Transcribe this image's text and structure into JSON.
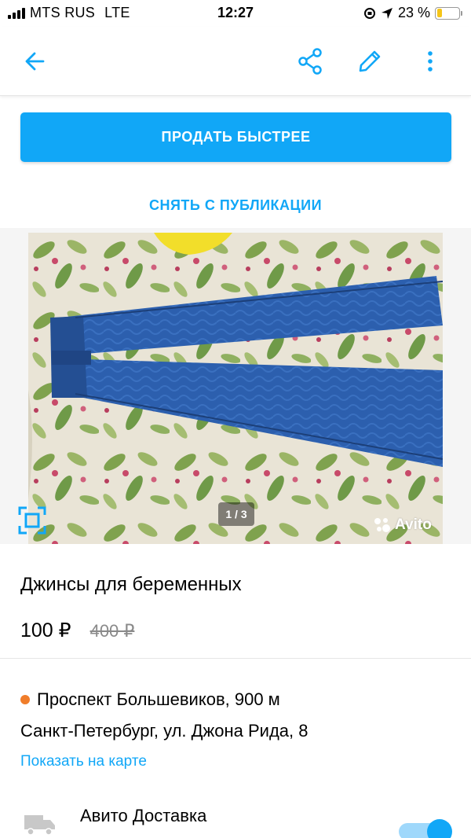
{
  "status_bar": {
    "carrier": "MTS RUS",
    "network": "LTE",
    "time": "12:27",
    "battery": "23 %",
    "battery_level": 0.23
  },
  "app_bar": {
    "icons": [
      "arrow-left-icon",
      "share-icon",
      "pencil-icon",
      "more-vertical-icon"
    ]
  },
  "actions": {
    "sell_faster": "ПРОДАТЬ БЫСТРЕЕ",
    "unpublish": "СНЯТЬ С ПУБЛИКАЦИИ"
  },
  "gallery": {
    "counter": "1 / 3",
    "watermark": "Avito"
  },
  "listing": {
    "title": "Джинсы для беременных",
    "price": "100 ₽",
    "old_price": "400 ₽"
  },
  "location": {
    "metro": "Проспект Большевиков, 900 м",
    "address": "Санкт-Петербург, ул. Джона Рида, 8",
    "show_on_map": "Показать на карте"
  },
  "delivery": {
    "label": "Авито Доставка",
    "enabled": true
  },
  "colors": {
    "accent": "#11a7f7",
    "metro_dot": "#f07d2a",
    "battery": "#f5c518"
  }
}
